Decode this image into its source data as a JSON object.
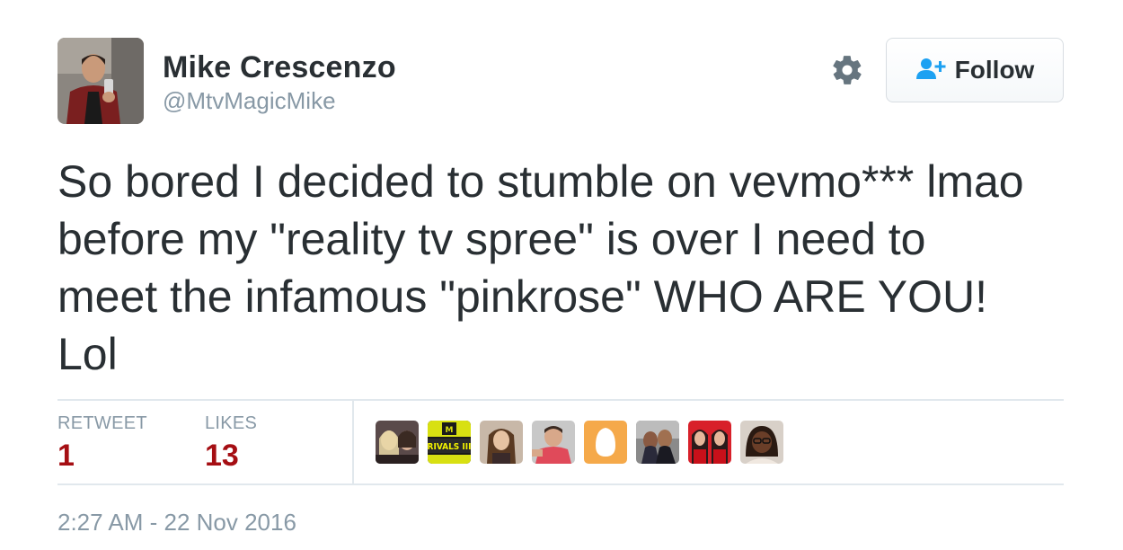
{
  "author": {
    "display_name": "Mike Crescenzo",
    "screen_name": "@MtvMagicMike",
    "avatar_icon": "profile-photo"
  },
  "actions": {
    "settings_icon": "gear-icon",
    "follow_icon": "add-user-icon",
    "follow_label": "Follow",
    "accent_color": "#1da1f2"
  },
  "tweet": {
    "lines": [
      "So bored I decided to stumble on vevmo*** lmao",
      "before my \"reality tv spree\" is over I need to",
      "meet the infamous \"pinkrose\" WHO ARE YOU!",
      "Lol"
    ]
  },
  "stats": {
    "retweet_label": "RETWEET",
    "retweet_count": "1",
    "likes_label": "LIKES",
    "likes_count": "13",
    "count_color": "#a50e13"
  },
  "likers": [
    {
      "icon": "liker-avatar-1"
    },
    {
      "icon": "liker-avatar-2",
      "text": "RIVALS III"
    },
    {
      "icon": "liker-avatar-3"
    },
    {
      "icon": "liker-avatar-4"
    },
    {
      "icon": "default-egg-avatar"
    },
    {
      "icon": "liker-avatar-6"
    },
    {
      "icon": "liker-avatar-7"
    },
    {
      "icon": "liker-avatar-8"
    }
  ],
  "timestamp": "2:27 AM - 22 Nov 2016"
}
